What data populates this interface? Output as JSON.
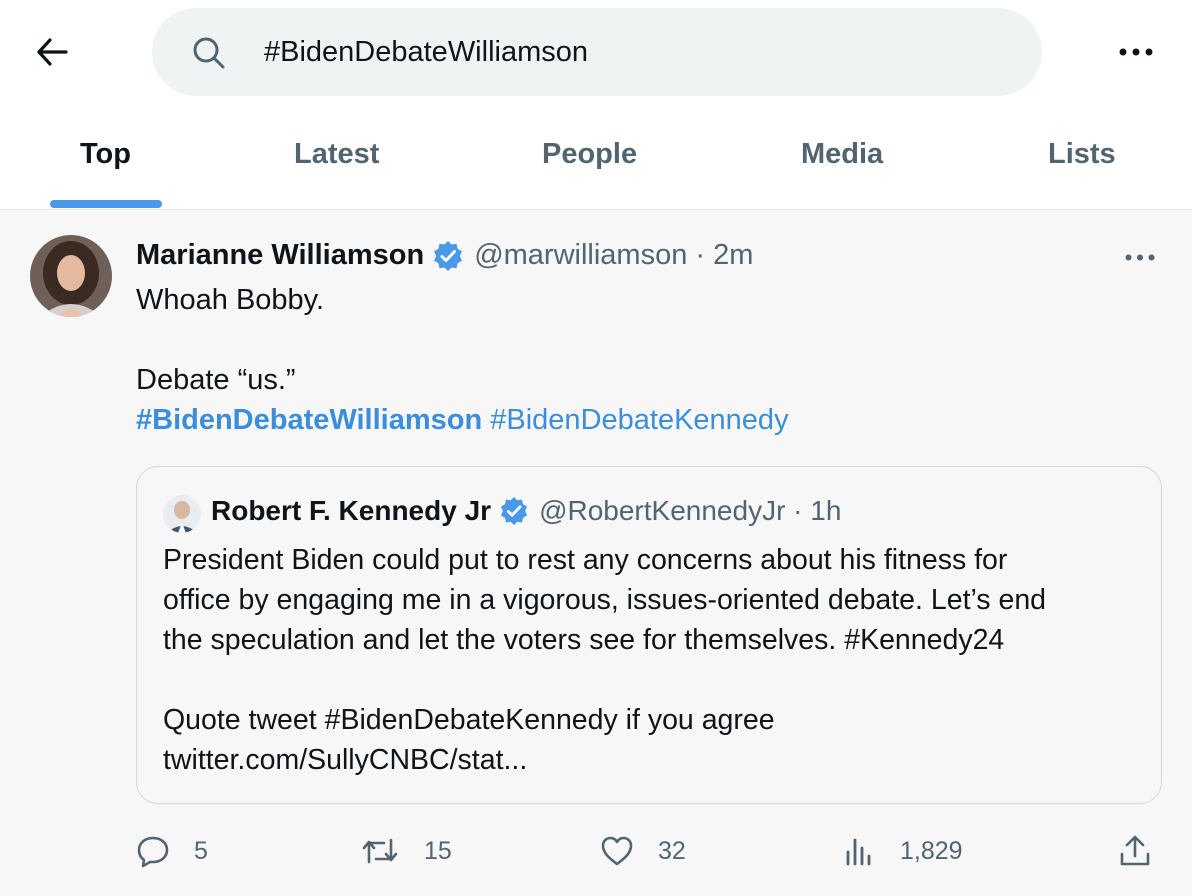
{
  "search": {
    "query": "#BidenDebateWilliamson"
  },
  "tabs": [
    {
      "label": "Top"
    },
    {
      "label": "Latest"
    },
    {
      "label": "People"
    },
    {
      "label": "Media"
    },
    {
      "label": "Lists"
    }
  ],
  "tweet": {
    "author_name": "Marianne Williamson",
    "handle_time": "@marwilliamson · 2m",
    "line1": "Whoah Bobby.",
    "line2": "Debate “us.”",
    "hashtag1": "#BidenDebateWilliamson",
    "hashtag2": "#BidenDebateKennedy",
    "quote": {
      "author_name": "Robert F. Kennedy Jr",
      "handle_time": "@RobertKennedyJr · 1h",
      "line1": "President Biden could put to rest any concerns about his fitness for",
      "line2": "office by engaging me in a vigorous, issues-oriented debate. Let’s end",
      "line3_text": "the speculation and let the voters see for themselves. ",
      "line3_tag": "#Kennedy24",
      "line4": "Quote tweet #BidenDebateKennedy if you agree",
      "line5": "twitter.com/SullyCNBC/stat..."
    },
    "actions": {
      "replies": "5",
      "retweets": "15",
      "likes": "32",
      "views": "1,829"
    }
  },
  "colors": {
    "accent": "#4a99e9",
    "hashtag": "#3a8edb",
    "secondary_text": "#536471",
    "search_bg": "#eff3f4",
    "verified": "#4a99e9"
  }
}
